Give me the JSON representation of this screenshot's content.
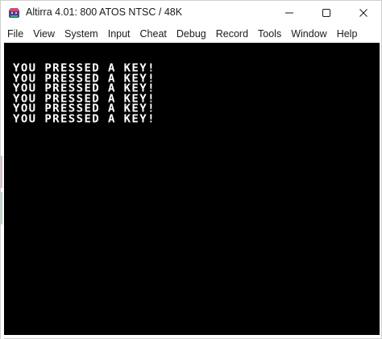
{
  "window": {
    "title": "Altirra 4.01: 800 ATOS NTSC / 48K",
    "app_icon": "altirra-app-icon",
    "controls": {
      "minimize_icon": "minimize-icon",
      "maximize_icon": "maximize-icon",
      "close_icon": "close-icon"
    }
  },
  "menubar": {
    "items": [
      {
        "label": "File"
      },
      {
        "label": "View"
      },
      {
        "label": "System"
      },
      {
        "label": "Input"
      },
      {
        "label": "Cheat"
      },
      {
        "label": "Debug"
      },
      {
        "label": "Record"
      },
      {
        "label": "Tools"
      },
      {
        "label": "Window"
      },
      {
        "label": "Help"
      }
    ]
  },
  "screen": {
    "background": "#000000",
    "text_color": "#ffffff",
    "lines": [
      "YOU PRESSED A KEY!",
      "YOU PRESSED A KEY!",
      "YOU PRESSED A KEY!",
      "YOU PRESSED A KEY!",
      "YOU PRESSED A KEY!",
      "YOU PRESSED A KEY!"
    ]
  }
}
